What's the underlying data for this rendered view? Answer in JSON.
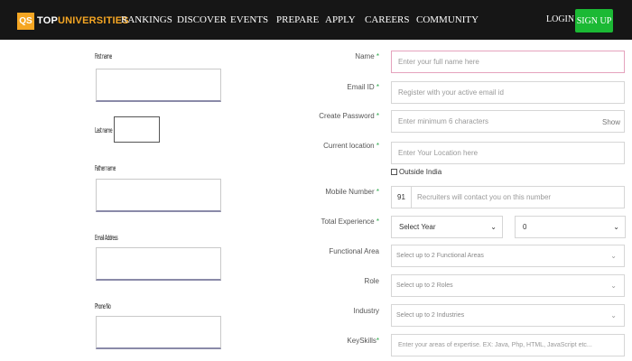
{
  "navbar": {
    "logo_box": "QS",
    "logo_top": "TOP",
    "logo_universities": "UNIVERSITIES",
    "links": [
      "RANKINGS",
      "DISCOVER",
      "EVENTS",
      "PREPARE",
      "APPLY",
      "CAREERS",
      "COMMUNITY"
    ],
    "login": "LOGIN",
    "signup": "SIGN UP"
  },
  "left_form": {
    "first_name": "First name",
    "last_name": "Last name",
    "father_name": "Father name",
    "email_address": "Email Address",
    "phone_no": "Phone No"
  },
  "right_form": {
    "name": {
      "label": "Name",
      "required": "*",
      "placeholder": "Enter your full name here"
    },
    "email": {
      "label": "Email ID",
      "required": "*",
      "placeholder": "Register with your active email id"
    },
    "password": {
      "label": "Create Password",
      "required": "*",
      "placeholder": "Enter minimum 6 characters",
      "show": "Show"
    },
    "location": {
      "label": "Current location",
      "required": "*",
      "placeholder": "Enter Your Location here"
    },
    "outside_india": "Outside India",
    "mobile": {
      "label": "Mobile Number",
      "required": "*",
      "code": "91",
      "placeholder": "Recruiters will contact you on this number"
    },
    "experience": {
      "label": "Total Experience",
      "required": "*",
      "year": "Select Year",
      "month": "0"
    },
    "functional_area": {
      "label": "Functional Area",
      "placeholder": "Select up to 2 Functional Areas"
    },
    "role": {
      "label": "Role",
      "placeholder": "Select up to 2 Roles"
    },
    "industry": {
      "label": "Industry",
      "placeholder": "Select up to 2 Industries"
    },
    "keyskills": {
      "label": "KeySkills",
      "required": "*",
      "placeholder": "Enter your areas of expertise. EX: Java, Php, HTML, JavaScript etc..."
    }
  },
  "colors": {
    "navbar": "#161616",
    "brand_orange": "#f5a623",
    "signup_green": "#1bb934",
    "required_green": "#2ba84a"
  }
}
